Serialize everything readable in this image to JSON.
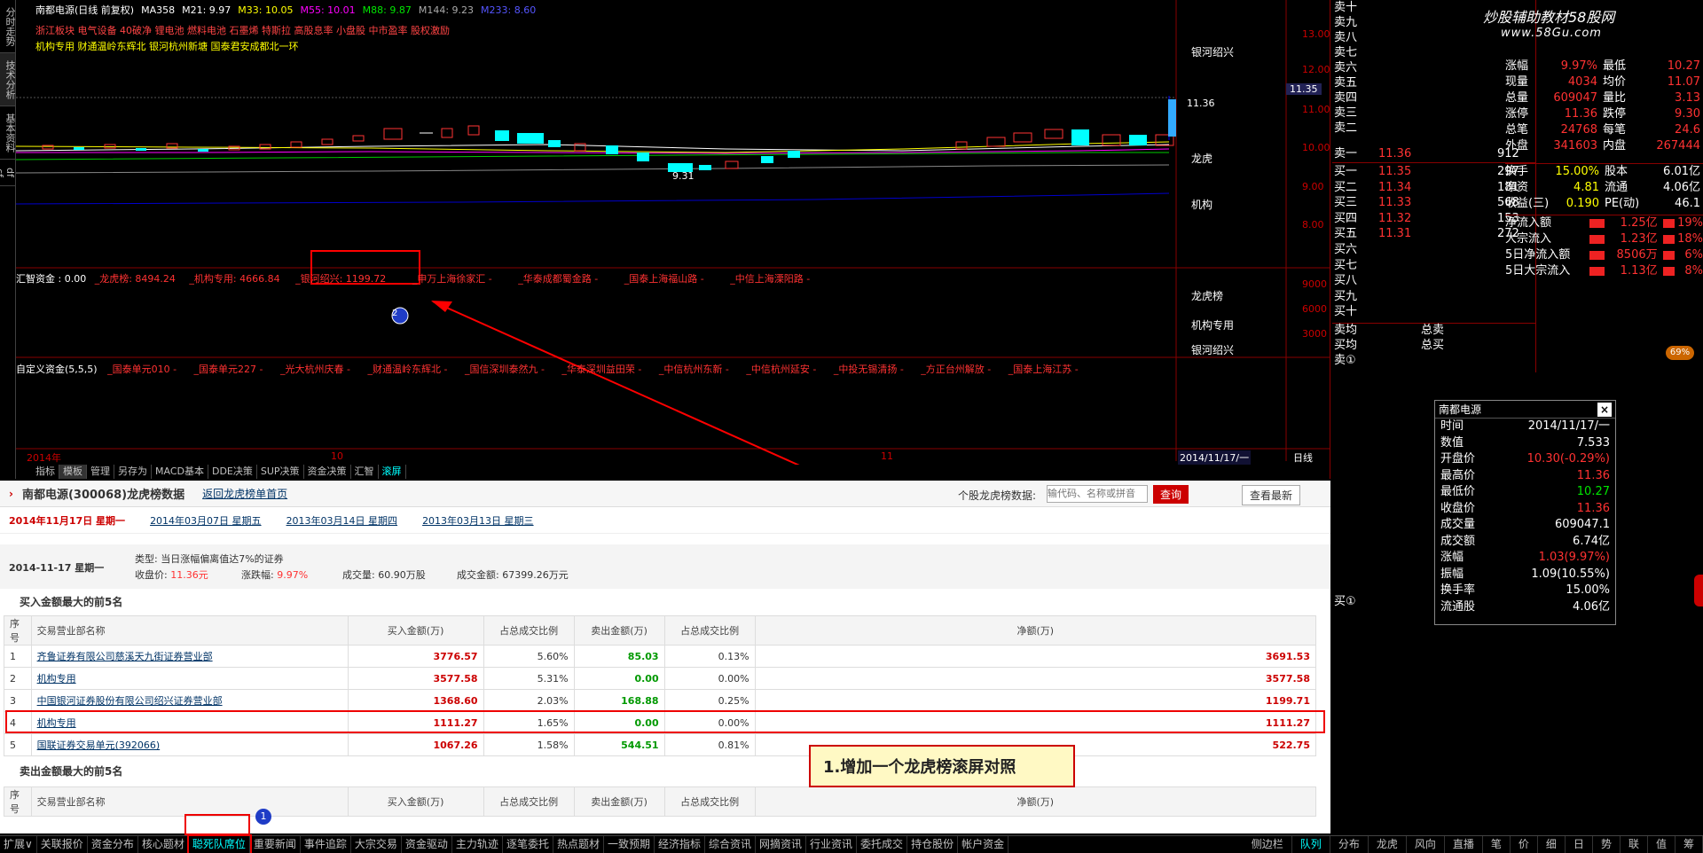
{
  "left_tabs": [
    "分时走势",
    "技术分析",
    "基本资料",
    "df cf"
  ],
  "top": {
    "title": "南都电源(日线 前复权)",
    "ma358": "MA358",
    "ma21": "M21: 9.97",
    "ma33": "M33: 10.05",
    "ma55": "M55: 10.01",
    "ma88": "M88: 9.87",
    "ma144": "M144: 9.23",
    "ma233": "M233: 8.60"
  },
  "concept_line1": "浙江板块 电气设备 40破净 锂电池 燃料电池 石墨烯 特斯拉 高股息率 小盘股 中市盈率 股权激励",
  "concept_line2": "机构专用 财通温岭东辉北 银河杭州新塘 国泰君安成都北一环",
  "right_labels": {
    "yh": "银河绍兴",
    "lh": "龙虎",
    "jg": "机构",
    "lhb": "龙虎榜",
    "jgzy": "机构专用",
    "yhsx": "银河绍兴"
  },
  "price_scale": [
    "13.00",
    "12.00",
    "11.00",
    "10.00",
    "9.00",
    "8.00"
  ],
  "price_current": "11.35",
  "high_label": "11.36",
  "low_label": "9.31",
  "huizhi": {
    "label": "汇智资金 : 0.00",
    "items": [
      "_龙虎榜: 8494.24",
      "_机构专用: 4666.84",
      "_银河绍兴: 1199.72",
      "_申万上海徐家汇 -",
      "_华泰成都蜀金路 -",
      "_国泰上海福山路 -",
      "_中信上海溧阳路 -"
    ]
  },
  "huizhi_scale": [
    "9000",
    "6000",
    "3000"
  ],
  "custom": {
    "label": "自定义资金(5,5,5)",
    "items": [
      "_国泰单元010 -",
      "_国泰单元227 -",
      "_光大杭州庆春 -",
      "_财通温岭东辉北 -",
      "_国信深圳泰然九 -",
      "_华泰深圳益田荣 -",
      "_中信杭州东新 -",
      "_中信杭州延安 -",
      "_中投无锡清扬 -",
      "_方正台州解放 -",
      "_国泰上海江苏 -"
    ]
  },
  "axis_dates": [
    "2014年",
    "10",
    "11",
    "2014/11/17/一"
  ],
  "daily_label": "日线",
  "bottom_tabs": [
    "指标",
    "模板",
    "管理",
    "另存为",
    "MACD基本",
    "DDE决策",
    "SUP决策",
    "资金决策",
    "汇智",
    "滚屏"
  ],
  "quote": {
    "sells": [
      "卖十",
      "卖九",
      "卖八",
      "卖七",
      "卖六",
      "卖五",
      "卖四",
      "卖三",
      "卖二",
      "卖一"
    ],
    "sell1_price": "11.36",
    "sell1_vol": "912",
    "buys": [
      {
        "l": "买一",
        "p": "11.35",
        "v": "297"
      },
      {
        "l": "买二",
        "p": "11.34",
        "v": "181"
      },
      {
        "l": "买三",
        "p": "11.33",
        "v": "568"
      },
      {
        "l": "买四",
        "p": "11.32",
        "v": "153"
      },
      {
        "l": "买五",
        "p": "11.31",
        "v": "272"
      },
      {
        "l": "买六",
        "p": "",
        "v": ""
      },
      {
        "l": "买七",
        "p": "",
        "v": ""
      },
      {
        "l": "买八",
        "p": "",
        "v": ""
      },
      {
        "l": "买九",
        "p": "",
        "v": ""
      },
      {
        "l": "买十",
        "p": "",
        "v": ""
      }
    ],
    "sell_avg": "卖均",
    "buy_avg": "买均",
    "total_sell": "总卖",
    "total_buy": "总买",
    "sell1b": "卖①",
    "buy1b": "买①"
  },
  "brand": "炒股辅助教材58股网",
  "brand_url": "www.58Gu.com",
  "stats": [
    [
      "涨幅",
      "9.97%",
      "最低",
      "10.27"
    ],
    [
      "现量",
      "4034",
      "均价",
      "11.07"
    ],
    [
      "总量",
      "609047",
      "量比",
      "3.13"
    ],
    [
      "涨停",
      "11.36",
      "跌停",
      "9.30"
    ],
    [
      "总笔",
      "24768",
      "每笔",
      "24.6"
    ],
    [
      "外盘",
      "341603",
      "内盘",
      "267444"
    ]
  ],
  "stats2": [
    [
      "换手",
      "15.00%",
      "股本",
      "6.01亿"
    ],
    [
      "净资",
      "4.81",
      "流通",
      "4.06亿"
    ],
    [
      "收益(三)",
      "0.190",
      "PE(动)",
      "46.1"
    ]
  ],
  "flows": [
    [
      "净流入额",
      "1.25亿",
      "19%"
    ],
    [
      "大宗流入",
      "1.23亿",
      "18%"
    ],
    [
      "5日净流入额",
      "8506万",
      "6%"
    ],
    [
      "5日大宗流入",
      "1.13亿",
      "8%"
    ]
  ],
  "badge": "69%",
  "popup": {
    "title": "南都电源",
    "rows": [
      [
        "时间",
        "2014/11/17/一"
      ],
      [
        "数值",
        "7.533"
      ],
      [
        "开盘价",
        "10.30(-0.29%)"
      ],
      [
        "最高价",
        "11.36"
      ],
      [
        "最低价",
        "10.27"
      ],
      [
        "收盘价",
        "11.36"
      ],
      [
        "成交量",
        "609047.1"
      ],
      [
        "成交额",
        "6.74亿"
      ],
      [
        "涨幅",
        "1.03(9.97%)"
      ],
      [
        "振幅",
        "1.09(10.55%)"
      ],
      [
        "换手率",
        "15.00%"
      ],
      [
        "流通股",
        "4.06亿"
      ]
    ]
  },
  "web": {
    "title": "南都电源(300068)龙虎榜数据",
    "back_link": "返回龙虎榜单首页",
    "search_label": "个股龙虎榜数据:",
    "search_placeholder": "输代码、名称或拼音",
    "search_btn": "查询",
    "latest_btn": "查看最新",
    "dates": [
      "2014年11月17日 星期一",
      "2014年03月07日 星期五",
      "2013年03月14日 星期四",
      "2013年03月13日 星期三"
    ],
    "info_date": "2014-11-17 星期一",
    "type_label": "类型: 当日涨幅偏离值达7%的证券",
    "close_label": "收盘价:",
    "close_val": "11.36元",
    "chg_label": "涨跌幅:",
    "chg_val": "9.97%",
    "vol_label": "成交量: 60.90万股",
    "amt_label": "成交金额: 67399.26万元",
    "buy_title": "买入金额最大的前5名",
    "sell_title": "卖出金额最大的前5名",
    "headers": [
      "序号",
      "交易营业部名称",
      "买入金额(万)",
      "占总成交比例",
      "卖出金额(万)",
      "占总成交比例",
      "净额(万)"
    ],
    "rows": [
      [
        "1",
        "齐鲁证券有限公司慈溪天九街证券营业部",
        "3776.57",
        "5.60%",
        "85.03",
        "0.13%",
        "3691.53"
      ],
      [
        "2",
        "机构专用",
        "3577.58",
        "5.31%",
        "0.00",
        "0.00%",
        "3577.58"
      ],
      [
        "3",
        "中国银河证券股份有限公司绍兴证券营业部",
        "1368.60",
        "2.03%",
        "168.88",
        "0.25%",
        "1199.71"
      ],
      [
        "4",
        "机构专用",
        "1111.27",
        "1.65%",
        "0.00",
        "0.00%",
        "1111.27"
      ],
      [
        "5",
        "国联证券交易单元(392066)",
        "1067.26",
        "1.58%",
        "544.51",
        "0.81%",
        "522.75"
      ]
    ]
  },
  "callout": "1.增加一个龙虎榜滚屏对照",
  "markers": [
    "1",
    "2"
  ],
  "status": [
    "扩展∨",
    "关联报价",
    "资金分布",
    "核心题材",
    "聪死队席位",
    "重要新闻",
    "事件追踪",
    "大宗交易",
    "资金驱动",
    "主力轨迹",
    "逐笔委托",
    "热点题材",
    "一致预期",
    "经济指标",
    "综合资讯",
    "网摘资讯",
    "行业资讯",
    "委托成交",
    "持仓股份",
    "帐户资金"
  ],
  "status_right": [
    "侧边栏",
    "队列",
    "分布",
    "龙虎",
    "风向",
    "直播",
    "笔",
    "价",
    "细",
    "日",
    "势",
    "联",
    "值",
    "筹"
  ]
}
